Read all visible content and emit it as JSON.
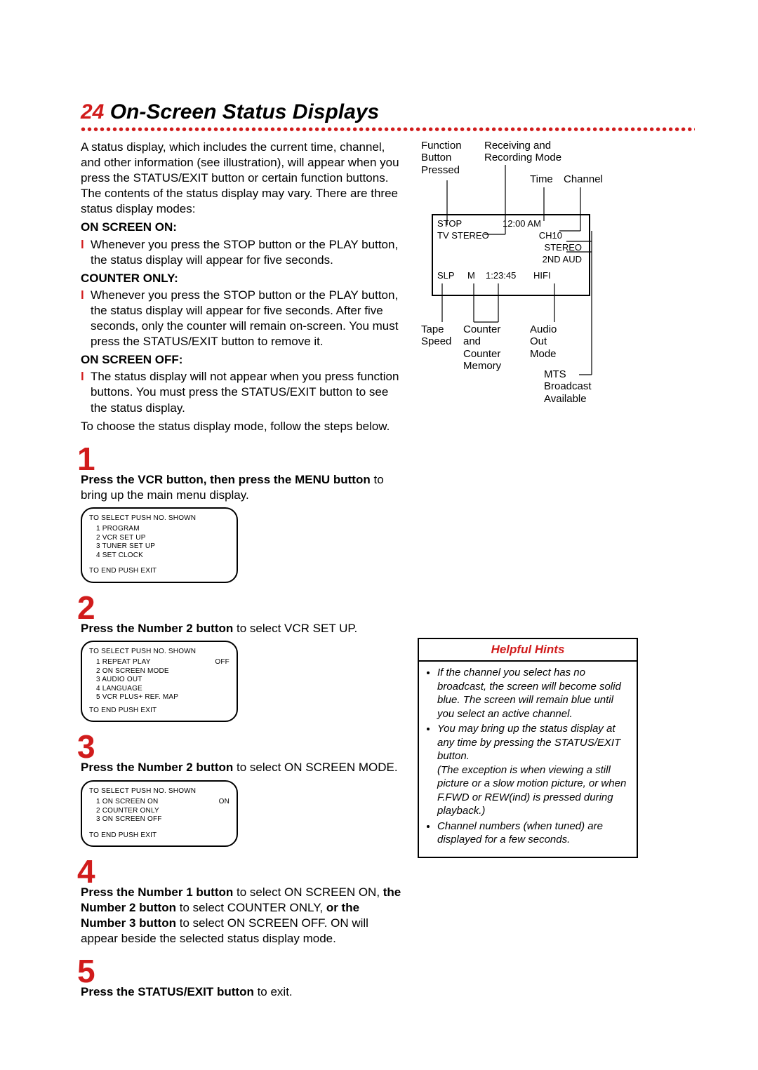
{
  "page_number": "24",
  "title": "On-Screen Status Displays",
  "intro": "A status display, which includes the current time, channel, and other information (see illustration), will appear when you press the STATUS/EXIT button or certain function buttons. The contents of the status display may vary. There are three status display modes:",
  "modes": {
    "on_screen_on": {
      "label": "ON SCREEN ON:",
      "text": "Whenever you press the STOP button or the PLAY button, the status display will appear for five seconds."
    },
    "counter_only": {
      "label": "COUNTER ONLY:",
      "text": "Whenever you press the STOP button or the PLAY button, the status display will appear for five seconds. After five seconds, only the counter will remain on-screen. You must press the STATUS/EXIT button to remove it."
    },
    "on_screen_off": {
      "label": "ON SCREEN OFF:",
      "text": "The status display will not appear when you press function buttons. You must press the STATUS/EXIT button to see the status display."
    }
  },
  "choose_line": "To choose the status display mode, follow the steps below.",
  "steps": {
    "s1": {
      "num": "1",
      "bold": "Press the VCR button, then press the MENU button",
      "rest": " to bring up the main menu display."
    },
    "s2": {
      "num": "2",
      "bold": "Press the Number 2 button",
      "rest": " to select VCR SET UP."
    },
    "s3": {
      "num": "3",
      "bold": "Press the Number 2 button",
      "rest": " to select ON SCREEN MODE."
    },
    "s4": {
      "num": "4",
      "bold1": "Press the Number 1 button",
      "mid1": " to select ON SCREEN ON, ",
      "bold2": "the Number 2 button",
      "mid2": " to select COUNTER ONLY, ",
      "bold3": "or the Number 3 button",
      "rest": " to select ON SCREEN OFF. ON will appear beside the selected status display mode."
    },
    "s5": {
      "num": "5",
      "bold": "Press the STATUS/EXIT button",
      "rest": " to exit."
    }
  },
  "menu1": {
    "head": "TO SELECT PUSH NO. SHOWN",
    "items": [
      "1  PROGRAM",
      "2  VCR SET UP",
      "3  TUNER SET UP",
      "4  SET CLOCK"
    ],
    "foot": "TO END PUSH EXIT"
  },
  "menu2": {
    "head": "TO SELECT PUSH NO. SHOWN",
    "items": [
      "1  REPEAT PLAY",
      "2  ON SCREEN MODE",
      "3  AUDIO OUT",
      "4  LANGUAGE",
      "5  VCR PLUS+ REF. MAP"
    ],
    "right": "OFF",
    "foot": "TO END PUSH EXIT"
  },
  "menu3": {
    "head": "TO SELECT PUSH NO. SHOWN",
    "items": [
      "1  ON SCREEN ON",
      "2  COUNTER ONLY",
      "3  ON SCREEN OFF"
    ],
    "right": "ON",
    "foot": "TO END PUSH EXIT"
  },
  "diagram": {
    "fn_button": "Function\nButton\nPressed",
    "receiving": "Receiving and\nRecording Mode",
    "time": "Time",
    "channel": "Channel",
    "osd": {
      "stop": "STOP",
      "tv_stereo": "TV STEREO",
      "time": "12:00 AM",
      "ch": "CH10",
      "stereo": "STEREO",
      "aud2": "2ND AUD",
      "slp": "SLP",
      "m": "M",
      "counter": "1:23:45",
      "hifi": "HIFI"
    },
    "tape_speed": "Tape\nSpeed",
    "counter_mem": "Counter\nand\nCounter\nMemory",
    "audio_out": "Audio\nOut\nMode",
    "mts": "MTS\nBroadcast\nAvailable"
  },
  "hints": {
    "title": "Helpful Hints",
    "items": [
      "If the channel you select has no broadcast, the screen will become solid blue. The screen will remain blue until you select an active channel.",
      "You may bring up the status display at any time by pressing the STATUS/EXIT button.\n(The exception is when viewing a still picture or a slow motion picture, or when F.FWD or REW(ind) is pressed during playback.)",
      "Channel numbers (when tuned) are displayed for a few seconds."
    ]
  }
}
